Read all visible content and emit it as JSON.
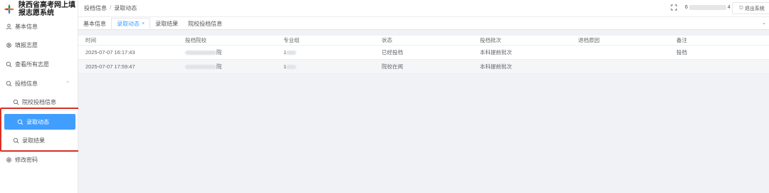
{
  "app": {
    "title_line1": "陕西省高考网上填",
    "title_line2": "报志愿系统"
  },
  "sidebar": {
    "items": [
      {
        "label": "基本信息",
        "icon": "user-icon"
      },
      {
        "label": "填报志愿",
        "icon": "gear-icon"
      },
      {
        "label": "查看所有志愿",
        "icon": "search-icon"
      },
      {
        "label": "投档信息",
        "icon": "search-icon"
      }
    ],
    "sub_items": [
      {
        "label": "院校投档信息",
        "icon": "search-icon"
      },
      {
        "label": "录取动态",
        "icon": "search-icon"
      },
      {
        "label": "录取结果",
        "icon": "search-icon"
      }
    ],
    "bottom_item": {
      "label": "修改密码",
      "icon": "gear-icon"
    }
  },
  "header": {
    "breadcrumb": [
      "投档信息",
      "录取动态"
    ],
    "breadcrumb_sep": "/",
    "user_prefix": "6",
    "user_suffix": "4",
    "logout_label": "退出系统"
  },
  "tabs": [
    {
      "label": "基本信息"
    },
    {
      "label": "录取动态",
      "close": "×"
    },
    {
      "label": "录取结果"
    },
    {
      "label": "院校投档信息"
    }
  ],
  "table": {
    "columns": [
      "时间",
      "投档院校",
      "专业组",
      "状态",
      "投档批次",
      "退档原因",
      "备注"
    ],
    "rows": [
      {
        "time": "2025-07-07 16:17:43",
        "school_suffix": "院",
        "major_prefix": "1",
        "status": "已经投档",
        "batch": "本科提前批次",
        "reason": "",
        "note": "投档"
      },
      {
        "time": "2025-07-07 17:59:47",
        "school_suffix": "院",
        "major_prefix": "1",
        "status": "院校在阅",
        "batch": "本科提前批次",
        "reason": "",
        "note": ""
      }
    ]
  },
  "colors": {
    "accent": "#409eff",
    "highlight": "#d93025"
  }
}
